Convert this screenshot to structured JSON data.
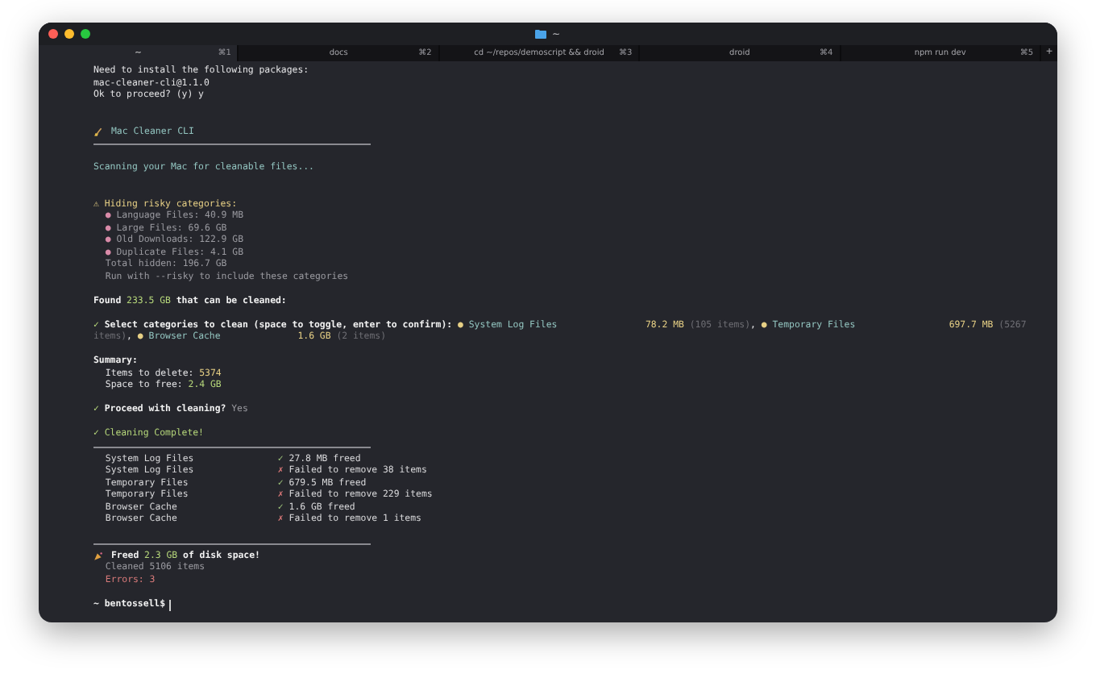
{
  "window": {
    "title": "~"
  },
  "tabs": [
    {
      "label": "~",
      "shortcut": "⌘1",
      "selected": true
    },
    {
      "label": "docs",
      "shortcut": "⌘2",
      "selected": false
    },
    {
      "label": "cd ~/repos/demoscript && droid",
      "shortcut": "⌘3",
      "selected": false
    },
    {
      "label": "droid",
      "shortcut": "⌘4",
      "selected": false
    },
    {
      "label": "npm run dev",
      "shortcut": "⌘5",
      "selected": false
    }
  ],
  "new_tab": "+",
  "lines": [
    {
      "kind": "text",
      "segments": [
        {
          "text": "Need to install the following packages:",
          "kind": "output"
        }
      ]
    },
    {
      "kind": "text",
      "segments": [
        {
          "text": "mac-cleaner-cli@1.1.0",
          "kind": "output"
        }
      ]
    },
    {
      "kind": "text",
      "segments": [
        {
          "text": "Ok to proceed? (y) y",
          "kind": "output"
        }
      ]
    },
    {
      "kind": "blank"
    },
    {
      "kind": "blank"
    },
    {
      "kind": "banner",
      "segments": [
        {
          "text": "Mac Cleaner CLI",
          "kind": "info"
        }
      ]
    },
    {
      "kind": "rule"
    },
    {
      "kind": "blank"
    },
    {
      "kind": "text",
      "segments": [
        {
          "text": "Scanning your Mac for cleanable files...",
          "kind": "info"
        }
      ]
    },
    {
      "kind": "blank"
    },
    {
      "kind": "blank"
    },
    {
      "kind": "text",
      "segments": [
        {
          "text": "⚠ Hiding risky categories:",
          "kind": "warning"
        }
      ]
    },
    {
      "kind": "detail",
      "segments": [
        {
          "text": "● ",
          "kind": "bullet"
        },
        {
          "text": "Language Files: 40.9 MB",
          "kind": "muted"
        }
      ]
    },
    {
      "kind": "detail",
      "segments": [
        {
          "text": "● ",
          "kind": "bullet"
        },
        {
          "text": "Large Files: 69.6 GB",
          "kind": "muted"
        }
      ]
    },
    {
      "kind": "detail",
      "segments": [
        {
          "text": "● ",
          "kind": "bullet"
        },
        {
          "text": "Old Downloads: 122.9 GB",
          "kind": "muted"
        }
      ]
    },
    {
      "kind": "detail",
      "segments": [
        {
          "text": "● ",
          "kind": "bullet"
        },
        {
          "text": "Duplicate Files: 4.1 GB",
          "kind": "muted"
        }
      ]
    },
    {
      "kind": "detail",
      "segments": [
        {
          "text": "Total hidden: 196.7 GB",
          "kind": "muted"
        }
      ]
    },
    {
      "kind": "detail",
      "segments": [
        {
          "text": "Run with --risky to include these categories",
          "kind": "muted"
        }
      ]
    },
    {
      "kind": "blank"
    },
    {
      "kind": "text",
      "segments": [
        {
          "text": "Found ",
          "kind": "heading"
        },
        {
          "text": "233.5 GB",
          "kind": "size"
        },
        {
          "text": " that can be cleaned:",
          "kind": "heading"
        }
      ]
    },
    {
      "kind": "blank"
    },
    {
      "kind": "text",
      "segments": [
        {
          "text": "✓ ",
          "kind": "check"
        },
        {
          "text": "Select categories to clean (space to toggle, enter to confirm): ",
          "kind": "heading"
        },
        {
          "text": "● ",
          "kind": "selected"
        },
        {
          "text": "System Log Files                ",
          "kind": "info"
        },
        {
          "text": "78.2 MB",
          "kind": "amount"
        },
        {
          "text": " (105 items)",
          "kind": "note"
        },
        {
          "text": ", ",
          "kind": "output"
        },
        {
          "text": "● ",
          "kind": "selected"
        },
        {
          "text": "Temporary Files                 ",
          "kind": "info"
        },
        {
          "text": "697.7 MB",
          "kind": "amount"
        },
        {
          "text": " (5267",
          "kind": "note"
        }
      ]
    },
    {
      "kind": "text",
      "segments": [
        {
          "text": "items)",
          "kind": "note"
        },
        {
          "text": ", ",
          "kind": "output"
        },
        {
          "text": "● ",
          "kind": "selected"
        },
        {
          "text": "Browser Cache              ",
          "kind": "info"
        },
        {
          "text": "1.6 GB",
          "kind": "amount"
        },
        {
          "text": " (2 items)",
          "kind": "note"
        }
      ]
    },
    {
      "kind": "blank"
    },
    {
      "kind": "text",
      "segments": [
        {
          "text": "Summary:",
          "kind": "heading"
        }
      ]
    },
    {
      "kind": "detail",
      "segments": [
        {
          "text": "Items to delete: ",
          "kind": "output"
        },
        {
          "text": "5374",
          "kind": "amount"
        }
      ]
    },
    {
      "kind": "detail",
      "segments": [
        {
          "text": "Space to free: ",
          "kind": "output"
        },
        {
          "text": "2.4 GB",
          "kind": "size"
        }
      ]
    },
    {
      "kind": "blank"
    },
    {
      "kind": "text",
      "segments": [
        {
          "text": "✓ ",
          "kind": "check"
        },
        {
          "text": "Proceed with cleaning? ",
          "kind": "heading"
        },
        {
          "text": "Yes",
          "kind": "muted"
        }
      ]
    },
    {
      "kind": "blank"
    },
    {
      "kind": "text",
      "segments": [
        {
          "text": "✓ Cleaning Complete!",
          "kind": "size"
        }
      ]
    },
    {
      "kind": "rule"
    },
    {
      "kind": "result",
      "label": "System Log Files",
      "ok": true,
      "mark": "✓",
      "message": "27.8 MB freed"
    },
    {
      "kind": "result",
      "label": "System Log Files",
      "ok": false,
      "mark": "✗",
      "message": "Failed to remove 38 items"
    },
    {
      "kind": "result",
      "label": "Temporary Files",
      "ok": true,
      "mark": "✓",
      "message": "679.5 MB freed"
    },
    {
      "kind": "result",
      "label": "Temporary Files",
      "ok": false,
      "mark": "✗",
      "message": "Failed to remove 229 items"
    },
    {
      "kind": "result",
      "label": "Browser Cache",
      "ok": true,
      "mark": "✓",
      "message": "1.6 GB freed"
    },
    {
      "kind": "result",
      "label": "Browser Cache",
      "ok": false,
      "mark": "✗",
      "message": "Failed to remove 1 items"
    },
    {
      "kind": "blank"
    },
    {
      "kind": "rule"
    },
    {
      "kind": "celebration",
      "segments": [
        {
          "text": "Freed ",
          "kind": "heading"
        },
        {
          "text": "2.3 GB",
          "kind": "size"
        },
        {
          "text": " of disk space!",
          "kind": "heading"
        }
      ]
    },
    {
      "kind": "detail",
      "segments": [
        {
          "text": "Cleaned 5106 items",
          "kind": "muted"
        }
      ]
    },
    {
      "kind": "detail",
      "segments": [
        {
          "text": "Errors: 3",
          "kind": "error"
        }
      ]
    },
    {
      "kind": "blank"
    },
    {
      "kind": "prompt",
      "segments": [
        {
          "text": "~ bentossell$",
          "kind": "heading"
        }
      ]
    }
  ]
}
